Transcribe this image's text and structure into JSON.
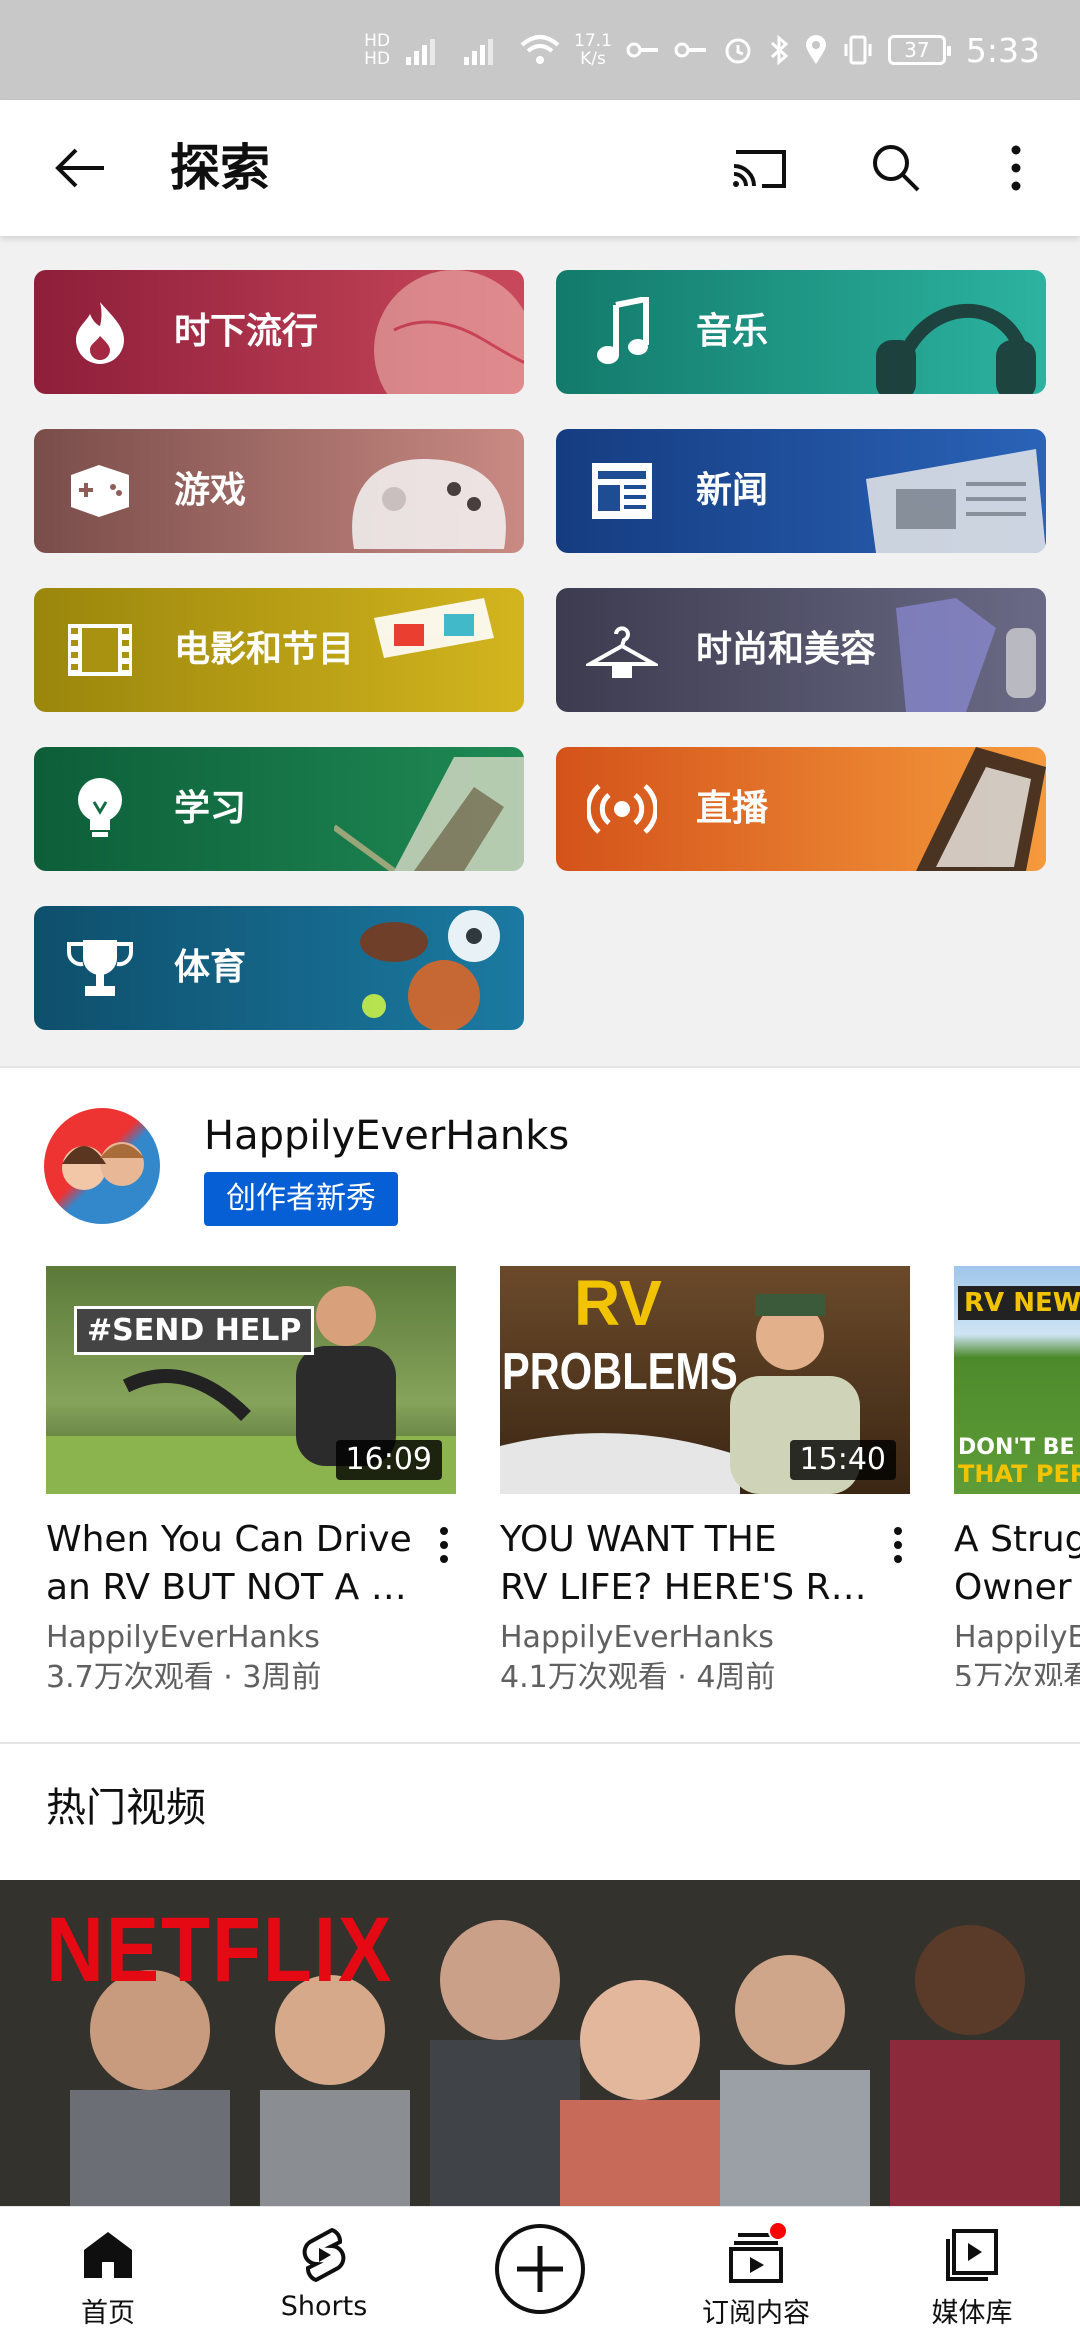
{
  "status_bar": {
    "network_speed": "17.1",
    "network_speed_unit": "K/s",
    "battery": "37",
    "time": "5:33"
  },
  "app_bar": {
    "title": "探索"
  },
  "categories": [
    {
      "label": "时下流行",
      "icon": "flame-icon",
      "color": "#a52842"
    },
    {
      "label": "音乐",
      "icon": "music-note-icon",
      "color": "#1f8f80"
    },
    {
      "label": "游戏",
      "icon": "gamepad-icon",
      "color": "#8f5c57"
    },
    {
      "label": "新闻",
      "icon": "newspaper-icon",
      "color": "#1e4d94"
    },
    {
      "label": "电影和节目",
      "icon": "film-strip-icon",
      "color": "#a8920f"
    },
    {
      "label": "时尚和美容",
      "icon": "hanger-icon",
      "color": "#4a4a5e"
    },
    {
      "label": "学习",
      "icon": "lightbulb-icon",
      "color": "#136d44"
    },
    {
      "label": "直播",
      "icon": "broadcast-icon",
      "color": "#e8641a"
    },
    {
      "label": "体育",
      "icon": "trophy-icon",
      "color": "#135f7d"
    }
  ],
  "creator": {
    "name": "HappilyEverHanks",
    "badge": "创作者新秀",
    "videos": [
      {
        "thumb_text": "#SEND HELP",
        "duration": "16:09",
        "title_line1": "When You Can Drive",
        "title_line2": "an RV BUT NOT A L…",
        "channel": "HappilyEverHanks",
        "stats": "3.7万次观看 · 3周前"
      },
      {
        "thumb_text": "RV",
        "thumb_text2": "PROBLEMS",
        "duration": "15:40",
        "title_line1": "YOU WANT THE",
        "title_line2": "RV LIFE? HERE'S R…",
        "channel": "HappilyEverHanks",
        "stats": "4.1万次观看 · 4周前"
      },
      {
        "thumb_text": "RV NEW",
        "thumb_text2": "DON'T BE",
        "thumb_text3": "THAT PERS",
        "title_line1": "A Strug",
        "title_line2": "Owner",
        "channel": "HappilyE",
        "stats": "5万次观看"
      }
    ]
  },
  "trending": {
    "title": "热门视频",
    "thumb_brand": "NETFLIX"
  },
  "bottom_nav": [
    {
      "label": "首页",
      "icon": "home-icon"
    },
    {
      "label": "Shorts",
      "icon": "shorts-icon"
    },
    {
      "label": "",
      "icon": "create-plus-icon"
    },
    {
      "label": "订阅内容",
      "icon": "subscriptions-icon"
    },
    {
      "label": "媒体库",
      "icon": "library-icon"
    }
  ]
}
